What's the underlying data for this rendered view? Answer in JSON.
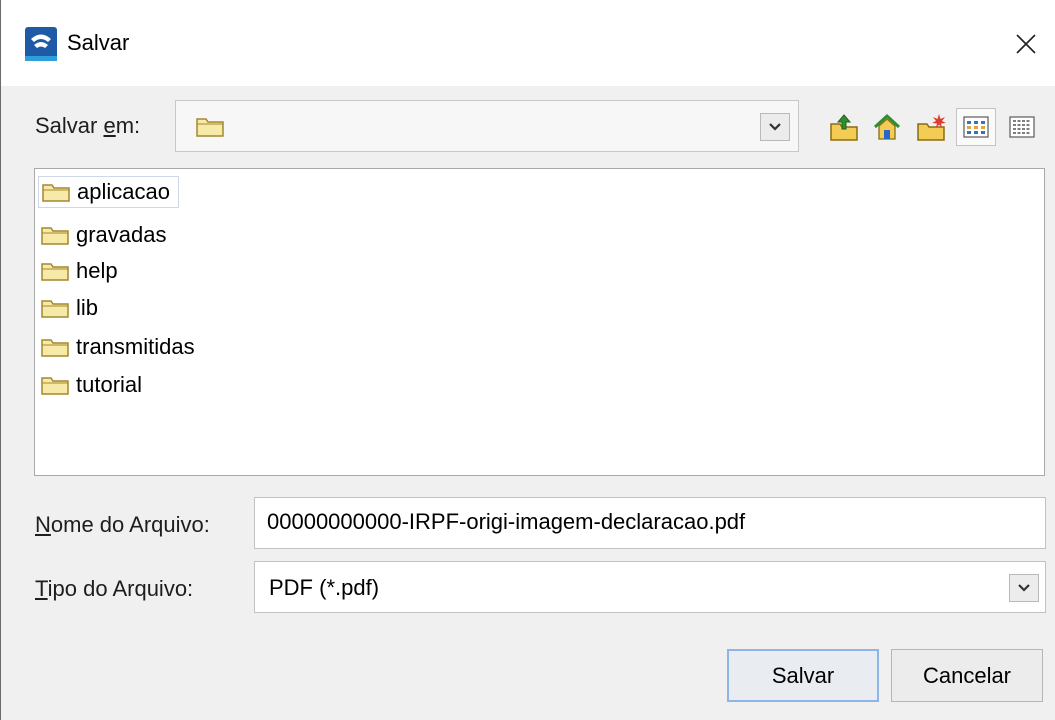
{
  "window": {
    "title": "Salvar",
    "icon": "app-logo-icon"
  },
  "toolbar": {
    "save_in_prefix": "Salvar ",
    "save_in_mnemonic": "e",
    "save_in_suffix": "m:",
    "current_folder": "",
    "buttons": [
      {
        "icon": "up-one-level-icon"
      },
      {
        "icon": "home-icon"
      },
      {
        "icon": "new-folder-icon"
      },
      {
        "icon": "list-view-icon"
      },
      {
        "icon": "details-view-icon"
      }
    ]
  },
  "files": [
    {
      "name": "aplicacao",
      "selected": true
    },
    {
      "name": "gravadas"
    },
    {
      "name": "help"
    },
    {
      "name": "lib"
    },
    {
      "name": "transmitidas"
    },
    {
      "name": "tutorial"
    }
  ],
  "filename": {
    "label_mnemonic": "N",
    "label_rest": "ome do Arquivo:",
    "value": "00000000000-IRPF-origi-imagem-declaracao.pdf"
  },
  "filetype": {
    "label_mnemonic": "T",
    "label_rest": "ipo do Arquivo:",
    "value": "PDF (*.pdf)"
  },
  "actions": {
    "save": "Salvar",
    "cancel": "Cancelar"
  },
  "colors": {
    "folder_fill": "#f7e9a8",
    "folder_stroke": "#a3892f",
    "default_button_border": "#8fb4e8"
  }
}
